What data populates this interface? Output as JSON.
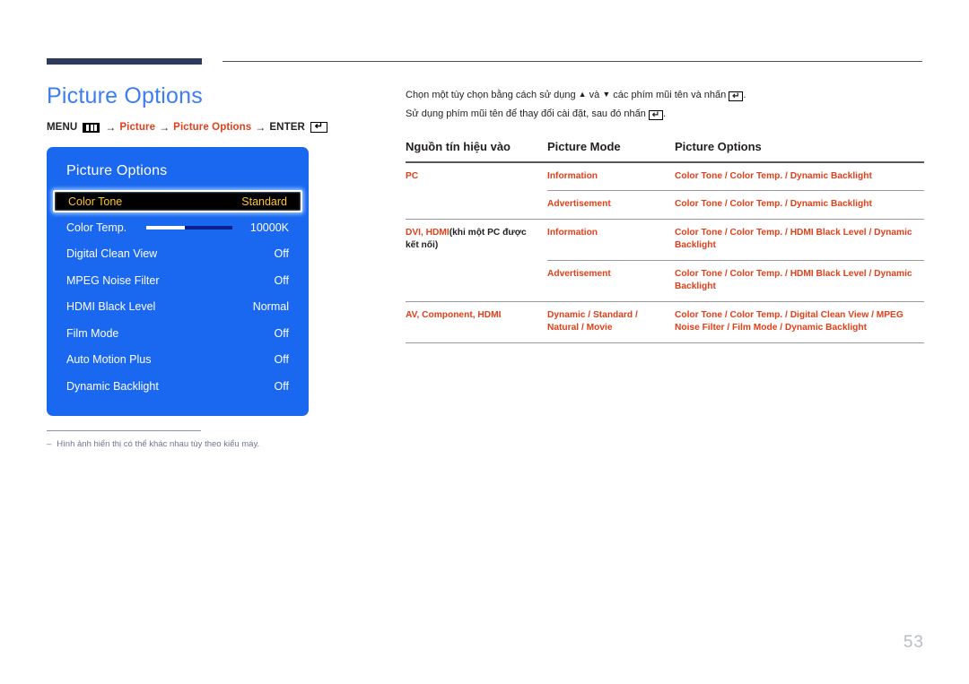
{
  "page_title": "Picture Options",
  "breadcrumb": {
    "menu_label": "MENU",
    "menu_icon": "menu-bars-icon",
    "arrow": "→",
    "item1": "Picture",
    "item2": "Picture Options",
    "enter_label": "ENTER",
    "enter_icon": "enter-key-icon"
  },
  "osd": {
    "title": "Picture Options",
    "rows": [
      {
        "label": "Color Tone",
        "value": "Standard",
        "selected": true,
        "slider": false
      },
      {
        "label": "Color Temp.",
        "value": "10000K",
        "selected": false,
        "slider": true,
        "slider_fill_percent": 45
      },
      {
        "label": "Digital Clean View",
        "value": "Off",
        "selected": false,
        "slider": false
      },
      {
        "label": "MPEG Noise Filter",
        "value": "Off",
        "selected": false,
        "slider": false
      },
      {
        "label": "HDMI Black Level",
        "value": "Normal",
        "selected": false,
        "slider": false
      },
      {
        "label": "Film Mode",
        "value": "Off",
        "selected": false,
        "slider": false
      },
      {
        "label": "Auto Motion Plus",
        "value": "Off",
        "selected": false,
        "slider": false
      },
      {
        "label": "Dynamic Backlight",
        "value": "Off",
        "selected": false,
        "slider": false
      }
    ]
  },
  "footnote": {
    "dash": "‒",
    "text": "Hình ảnh hiển thị có thể khác nhau tùy theo kiểu máy."
  },
  "intro": {
    "line1_a": "Chọn một tùy chọn bằng cách sử dụng ",
    "line1_up": "▲",
    "line1_b": " và ",
    "line1_down": "▼",
    "line1_c": " các phím mũi tên và nhấn ",
    "line1_d": ".",
    "line2_a": "Sử dụng phím mũi tên để thay đổi cài đặt, sau đó nhấn ",
    "line2_b": "."
  },
  "table": {
    "headers": {
      "source": "Nguồn tín hiệu vào",
      "mode": "Picture Mode",
      "options": "Picture Options"
    },
    "rows": [
      {
        "source": "PC",
        "source_suffix": "",
        "mode": "Information",
        "options": "Color Tone / Color Temp. / Dynamic Backlight",
        "divider": "none"
      },
      {
        "source": "",
        "source_suffix": "",
        "mode": "Advertisement",
        "options": "Color Tone / Color Temp. / Dynamic Backlight",
        "divider": "partial"
      },
      {
        "source": "DVI, HDMI",
        "source_suffix": "(khi một PC được kết nối)",
        "mode": "Information",
        "options": "Color Tone / Color Temp. / HDMI Black Level / Dynamic Backlight",
        "divider": "full"
      },
      {
        "source": "",
        "source_suffix": "",
        "mode": "Advertisement",
        "options": "Color Tone / Color Temp. / HDMI Black Level / Dynamic Backlight",
        "divider": "partial"
      },
      {
        "source": "AV, Component, HDMI",
        "source_suffix": "",
        "mode": "Dynamic / Standard / Natural / Movie",
        "options": "Color Tone / Color Temp. / Digital Clean View / MPEG Noise Filter / Film Mode / Dynamic Backlight",
        "divider": "full"
      }
    ]
  },
  "page_number": "53",
  "colors": {
    "heading_blue": "#3d7ef0",
    "accent_red": "#e0401a",
    "osd_blue": "#1a67f0",
    "osd_highlight_text": "#ffc425",
    "rule_navy": "#2e3a5c"
  }
}
